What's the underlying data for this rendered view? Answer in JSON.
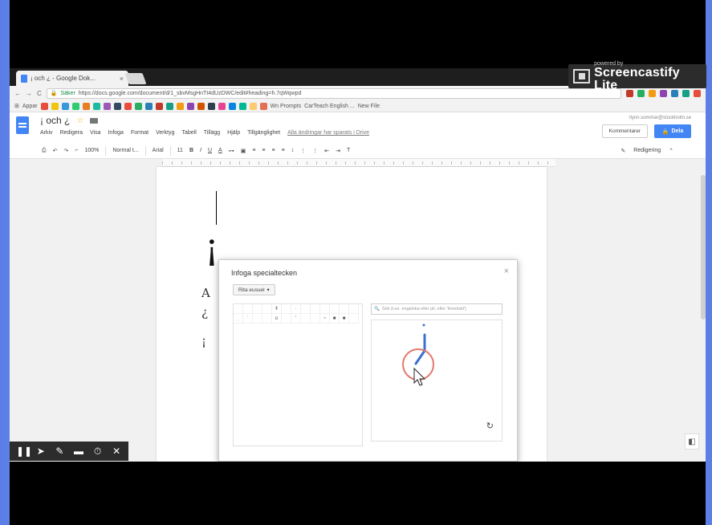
{
  "browser": {
    "tab_title": "¡ och ¿ - Google Dok...",
    "tab_close": "×",
    "url_secure_label": "Säker",
    "url": "https://docs.google.com/document/d/1_sbvMsgHnTt4dUzDWC/edit#heading=h.7qWqwpd",
    "bookmarks": [
      "Appar",
      "Wn Prompts",
      "CarTeach English ...",
      "New File"
    ]
  },
  "screencastify": {
    "powered_by": "powered by",
    "name": "Screencastify Lite"
  },
  "docs": {
    "title": "¡ och ¿",
    "menu": [
      "Arkiv",
      "Redigera",
      "Visa",
      "Infoga",
      "Format",
      "Verktyg",
      "Tabell",
      "Tillägg",
      "Hjälp",
      "Tillgänglighet"
    ],
    "save_status": "Alla ändringar har sparats i Drive",
    "user_email": "rlynn.sommar@stockholm.se",
    "comments_label": "Kommentarer",
    "share_label": "Dela",
    "toolbar": {
      "zoom": "100%",
      "style": "Normal t...",
      "font": "Arial",
      "font_size": "11",
      "editing_mode": "Redigering"
    },
    "page": {
      "big_char": "¡",
      "lines": [
        "A",
        "¿",
        "¡"
      ]
    }
  },
  "dialog": {
    "title": "Infoga specialtecken",
    "dropdown": "Rita eusuel",
    "search_placeholder": "Sök (t.ex. engelska eller pil, eller 'fonetiskt')",
    "grid_chars": [
      [
        "",
        "",
        "",
        "",
        "ǂ",
        "",
        "·",
        "",
        "",
        "",
        "",
        "",
        ""
      ],
      [
        "ˌ",
        "ˈ",
        "",
        "",
        "ʊ",
        "",
        "'",
        "",
        "",
        "~",
        "■",
        "■",
        ""
      ]
    ]
  }
}
